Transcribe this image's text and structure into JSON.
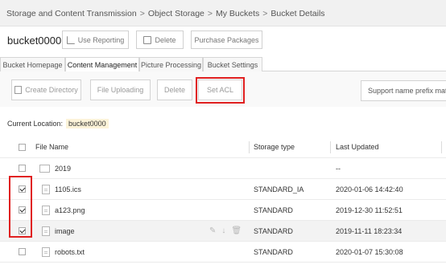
{
  "breadcrumb": [
    "Storage and Content Transmission",
    "Object Storage",
    "My Buckets",
    "Bucket Details"
  ],
  "breadcrumb_separator": ">",
  "bucket": {
    "name": "bucket0000"
  },
  "header_buttons": {
    "use_reporting": "Use Reporting",
    "delete": "Delete",
    "purchase_packages": "Purchase Packages"
  },
  "tabs": [
    "Bucket Homepage",
    "Content Management",
    "Picture Processing",
    "Bucket Settings"
  ],
  "active_tab": "Content Management",
  "toolbar": {
    "create_directory": "Create Directory",
    "file_uploading": "File Uploading",
    "delete": "Delete",
    "set_acl": "Set ACL",
    "search_placeholder": "Support name prefix match"
  },
  "location": {
    "label": "Current Location:",
    "value": "bucket0000"
  },
  "table": {
    "columns": [
      "File Name",
      "Storage type",
      "Last Updated"
    ],
    "rows": [
      {
        "name": "2019",
        "type": "folder",
        "storage": "",
        "updated": "--",
        "checked": false
      },
      {
        "name": "1105.ics",
        "type": "file",
        "storage": "STANDARD_IA",
        "updated": "2020-01-06 14:42:40",
        "checked": true
      },
      {
        "name": "a123.png",
        "type": "file",
        "storage": "STANDARD",
        "updated": "2019-12-30 11:52:51",
        "checked": true
      },
      {
        "name": "image",
        "type": "file",
        "storage": "STANDARD",
        "updated": "2019-11-11 18:23:34",
        "checked": true
      },
      {
        "name": "robots.txt",
        "type": "file",
        "storage": "STANDARD",
        "updated": "2020-01-07 15:30:08",
        "checked": false
      }
    ],
    "row_actions": [
      "edit-icon",
      "download-icon",
      "delete-icon"
    ]
  },
  "colors": {
    "highlight": "#e02020",
    "location_bg": "#fcf3d9"
  }
}
